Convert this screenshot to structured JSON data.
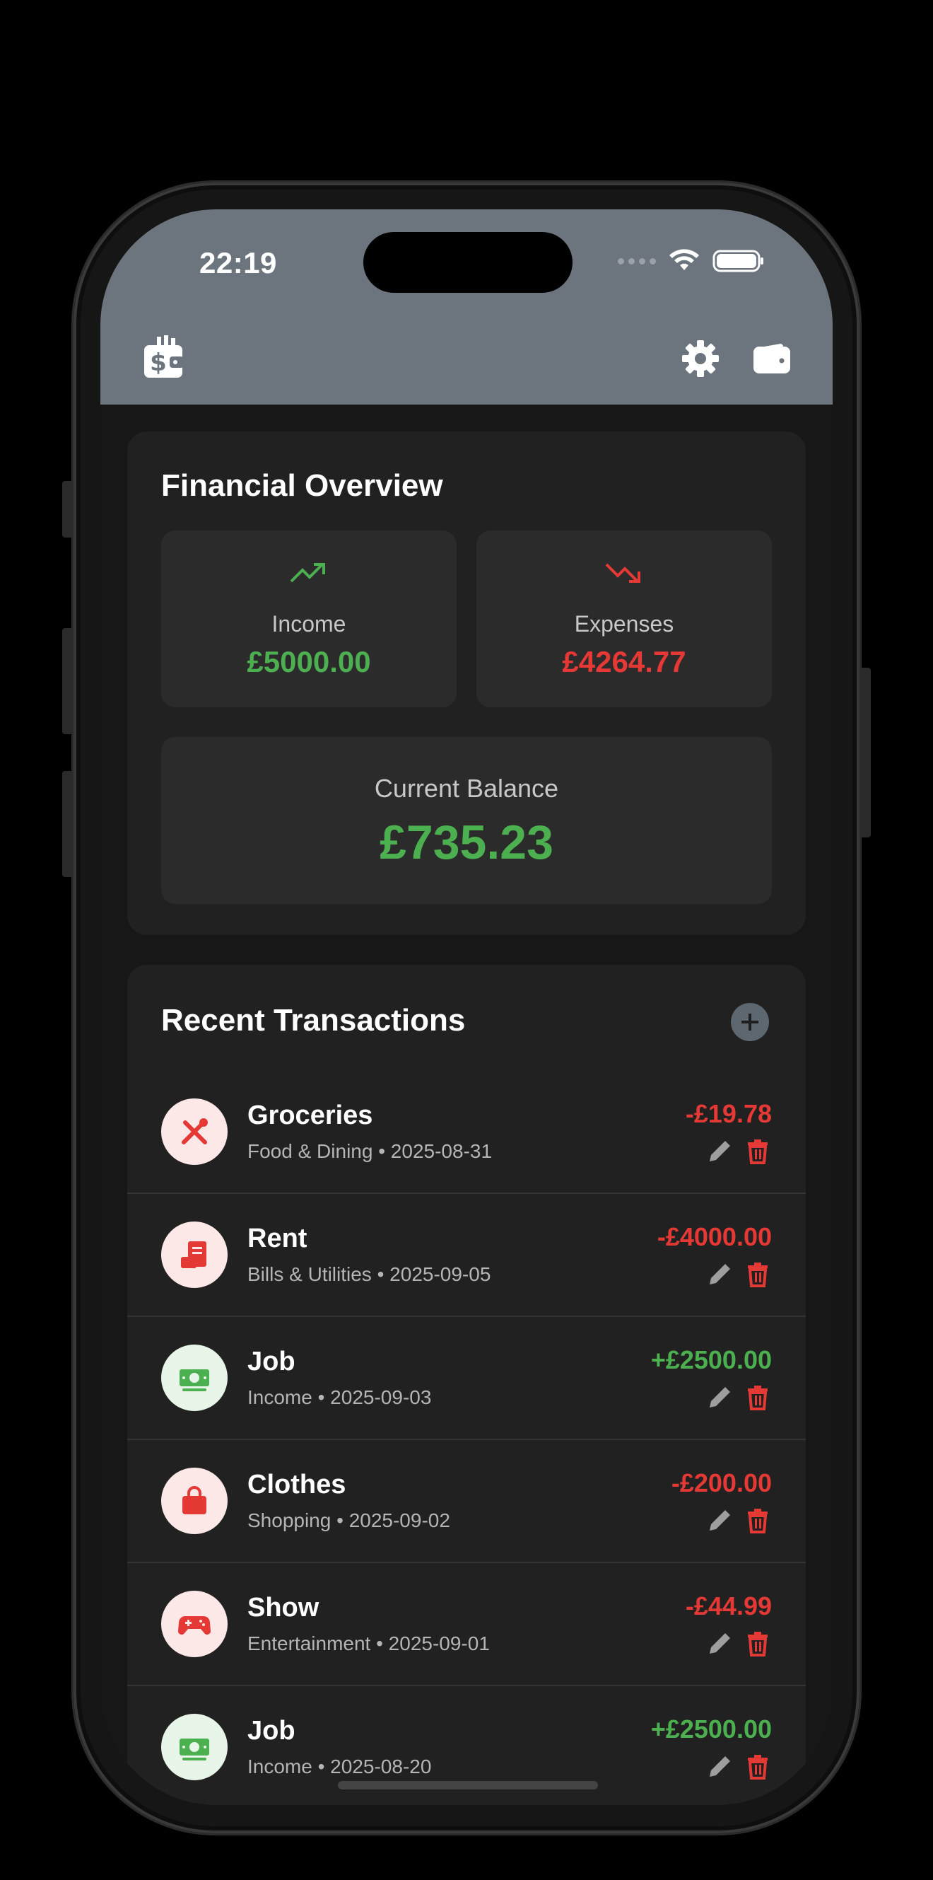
{
  "status_bar": {
    "time": "22:19"
  },
  "colors": {
    "accent": "#6c757d",
    "income": "#4caf50",
    "expense": "#e53935"
  },
  "header": {
    "left_icon": "wallet-dollar-icon",
    "right_icons": [
      "gear-icon",
      "wallet-icon"
    ]
  },
  "overview": {
    "title": "Financial Overview",
    "income": {
      "label": "Income",
      "value": "£5000.00",
      "icon": "trending-up-icon"
    },
    "expenses": {
      "label": "Expenses",
      "value": "£4264.77",
      "icon": "trending-down-icon"
    },
    "balance": {
      "label": "Current Balance",
      "value": "£735.23"
    }
  },
  "transactions": {
    "title": "Recent Transactions",
    "add_icon": "plus-circle-icon",
    "items": [
      {
        "name": "Groceries",
        "category": "Food & Dining",
        "date": "2025-08-31",
        "meta": "Food & Dining • 2025-08-31",
        "amount": "-£19.78",
        "type": "expense",
        "icon": "utensils-icon"
      },
      {
        "name": "Rent",
        "category": "Bills & Utilities",
        "date": "2025-09-05",
        "meta": "Bills & Utilities • 2025-09-05",
        "amount": "-£4000.00",
        "type": "expense",
        "icon": "receipt-icon"
      },
      {
        "name": "Job",
        "category": "Income",
        "date": "2025-09-03",
        "meta": "Income • 2025-09-03",
        "amount": "+£2500.00",
        "type": "income",
        "icon": "money-icon"
      },
      {
        "name": "Clothes",
        "category": "Shopping",
        "date": "2025-09-02",
        "meta": "Shopping • 2025-09-02",
        "amount": "-£200.00",
        "type": "expense",
        "icon": "shopping-bag-icon"
      },
      {
        "name": "Show",
        "category": "Entertainment",
        "date": "2025-09-01",
        "meta": "Entertainment • 2025-09-01",
        "amount": "-£44.99",
        "type": "expense",
        "icon": "gamepad-icon"
      },
      {
        "name": "Job",
        "category": "Income",
        "date": "2025-08-20",
        "meta": "Income • 2025-08-20",
        "amount": "+£2500.00",
        "type": "income",
        "icon": "money-icon"
      }
    ]
  }
}
